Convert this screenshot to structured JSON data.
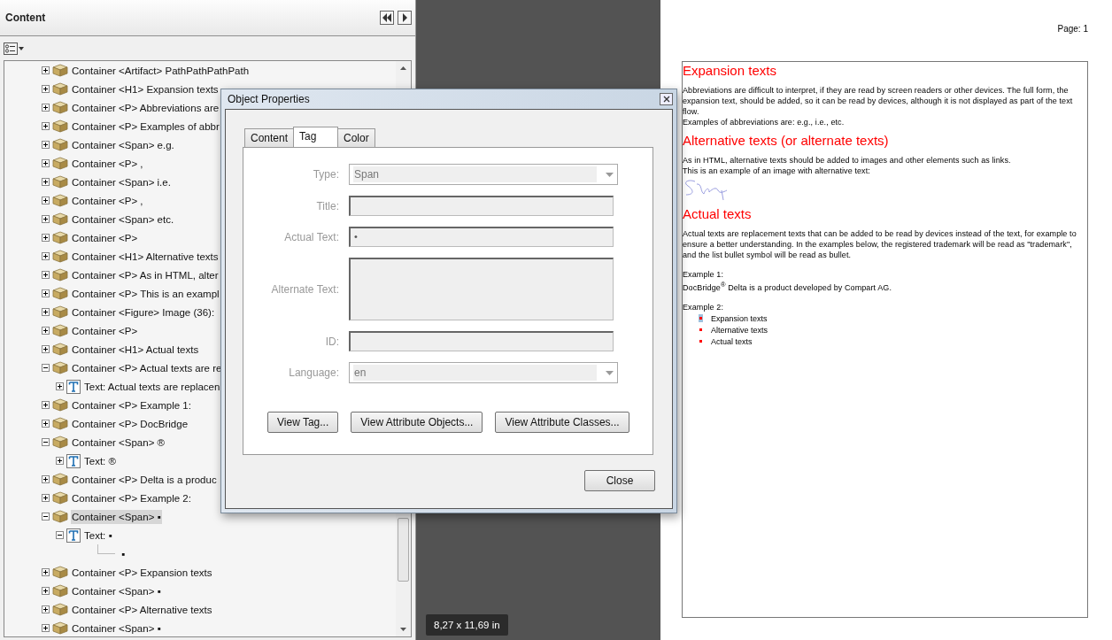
{
  "panel": {
    "title": "Content",
    "tree": [
      {
        "kind": "container",
        "label": "Container <Artifact> PathPathPathPath",
        "expanded": false,
        "selected": false
      },
      {
        "kind": "container",
        "label": "Container <H1> Expansion texts",
        "expanded": false,
        "selected": false
      },
      {
        "kind": "container",
        "label": "Container <P> Abbreviations are",
        "expanded": false,
        "selected": false
      },
      {
        "kind": "container",
        "label": "Container <P> Examples of abbr",
        "expanded": false,
        "selected": false
      },
      {
        "kind": "container",
        "label": "Container <Span> e.g.",
        "expanded": false,
        "selected": false
      },
      {
        "kind": "container",
        "label": "Container <P> ,",
        "expanded": false,
        "selected": false
      },
      {
        "kind": "container",
        "label": "Container <Span> i.e.",
        "expanded": false,
        "selected": false
      },
      {
        "kind": "container",
        "label": "Container <P> ,",
        "expanded": false,
        "selected": false
      },
      {
        "kind": "container",
        "label": "Container <Span> etc.",
        "expanded": false,
        "selected": false
      },
      {
        "kind": "container",
        "label": "Container <P>",
        "expanded": false,
        "selected": false
      },
      {
        "kind": "container",
        "label": "Container <H1> Alternative texts",
        "expanded": false,
        "selected": false
      },
      {
        "kind": "container",
        "label": "Container <P> As in HTML, alter",
        "expanded": false,
        "selected": false
      },
      {
        "kind": "container",
        "label": "Container <P> This is an exampl",
        "expanded": false,
        "selected": false
      },
      {
        "kind": "container",
        "label": "Container <Figure> Image (36):",
        "expanded": false,
        "selected": false
      },
      {
        "kind": "container",
        "label": "Container <P>",
        "expanded": false,
        "selected": false
      },
      {
        "kind": "container",
        "label": "Container <H1> Actual texts",
        "expanded": false,
        "selected": false
      },
      {
        "kind": "container",
        "label": "Container <P> Actual texts are re",
        "expanded": true,
        "selected": false,
        "children": [
          {
            "kind": "text",
            "label": "Text: Actual texts are replacen",
            "expanded": false,
            "selected": false
          }
        ]
      },
      {
        "kind": "container",
        "label": "Container <P> Example 1:",
        "expanded": false,
        "selected": false
      },
      {
        "kind": "container",
        "label": "Container <P> DocBridge",
        "expanded": false,
        "selected": false
      },
      {
        "kind": "container",
        "label": "Container <Span> ®",
        "expanded": true,
        "selected": false,
        "children": [
          {
            "kind": "text",
            "label": "Text: ®",
            "expanded": false,
            "selected": false
          }
        ]
      },
      {
        "kind": "container",
        "label": "Container <P>  Delta is a produc",
        "expanded": false,
        "selected": false
      },
      {
        "kind": "container",
        "label": "Container <P> Example 2:",
        "expanded": false,
        "selected": false
      },
      {
        "kind": "container",
        "label": "Container <Span> ▪",
        "expanded": true,
        "selected": true,
        "children": [
          {
            "kind": "text",
            "label": "Text: ▪",
            "expanded": true,
            "selected": false,
            "children": [
              {
                "kind": "glyph",
                "label": "▪",
                "selected": false
              }
            ]
          }
        ]
      },
      {
        "kind": "container",
        "label": "Container <P> Expansion texts",
        "expanded": false,
        "selected": false
      },
      {
        "kind": "container",
        "label": "Container <Span> ▪",
        "expanded": false,
        "selected": false
      },
      {
        "kind": "container",
        "label": "Container <P> Alternative texts",
        "expanded": false,
        "selected": false
      },
      {
        "kind": "container",
        "label": "Container <Span> ▪",
        "expanded": false,
        "selected": false
      }
    ]
  },
  "dialog": {
    "title": "Object Properties",
    "tabs": [
      {
        "label": "Content",
        "selected": false
      },
      {
        "label": "Tag",
        "selected": true
      },
      {
        "label": "Color",
        "selected": false
      }
    ],
    "fields": [
      {
        "kind": "dropdown",
        "label": "Type:",
        "value": "Span",
        "disabled": true
      },
      {
        "kind": "text",
        "label": "Title:",
        "disabled": true
      },
      {
        "kind": "text",
        "label": "Actual Text:",
        "value": "•",
        "disabled": true
      },
      {
        "kind": "textarea",
        "label": "Alternate Text:",
        "disabled": true
      },
      {
        "kind": "text",
        "label": "ID:",
        "disabled": true
      },
      {
        "kind": "dropdown",
        "label": "Language:",
        "value": "en",
        "disabled": true
      }
    ],
    "buttons": [
      "View Tag...",
      "View Attribute Objects...",
      "View Attribute Classes..."
    ],
    "close_button": "Close"
  },
  "document": {
    "page_label": "Page: 1",
    "blocks": [
      {
        "kind": "heading",
        "text": "Expansion texts"
      },
      {
        "kind": "paragraph",
        "text": "Abbreviations are difficult to interpret, if they are read by screen readers or other devices. The full form, the expansion text, should be added, so it can be read by devices, although it is not displayed as part of the text flow."
      },
      {
        "kind": "paragraph",
        "text": "Examples of abbreviations are: e.g., i.e., etc."
      },
      {
        "kind": "heading",
        "text": "Alternative texts (or alternate texts)"
      },
      {
        "kind": "paragraph",
        "text": "As in HTML, alternative texts should be added to images and other elements such as links."
      },
      {
        "kind": "paragraph",
        "text": "This is an example of an image with alternative text:"
      },
      {
        "kind": "signature"
      },
      {
        "kind": "heading",
        "text": "Actual texts"
      },
      {
        "kind": "paragraph",
        "text": "Actual texts are replacement texts that can be added to be read by devices instead of the text, for example to ensure a better understanding. In the examples below, the registered trademark will be read as \"trademark\", and the list bullet symbol will be read as bullet."
      },
      {
        "kind": "gap"
      },
      {
        "kind": "paragraph",
        "text": "Example 1:"
      },
      {
        "kind": "paragraph",
        "text": "DocBridge$^{®}$ Delta is a product developed by Compart AG."
      },
      {
        "kind": "gap"
      },
      {
        "kind": "paragraph",
        "text": "Example 2:"
      },
      {
        "kind": "list",
        "items": [
          {
            "text": "Expansion texts",
            "color": "#ff0000",
            "selected": true
          },
          {
            "text": "Alternative texts",
            "color": "#ff0000",
            "selected": false
          },
          {
            "text": "Actual texts",
            "color": "#ff0000",
            "selected": false
          }
        ]
      }
    ]
  },
  "size_tooltip": "8,27 x 11,69 in"
}
